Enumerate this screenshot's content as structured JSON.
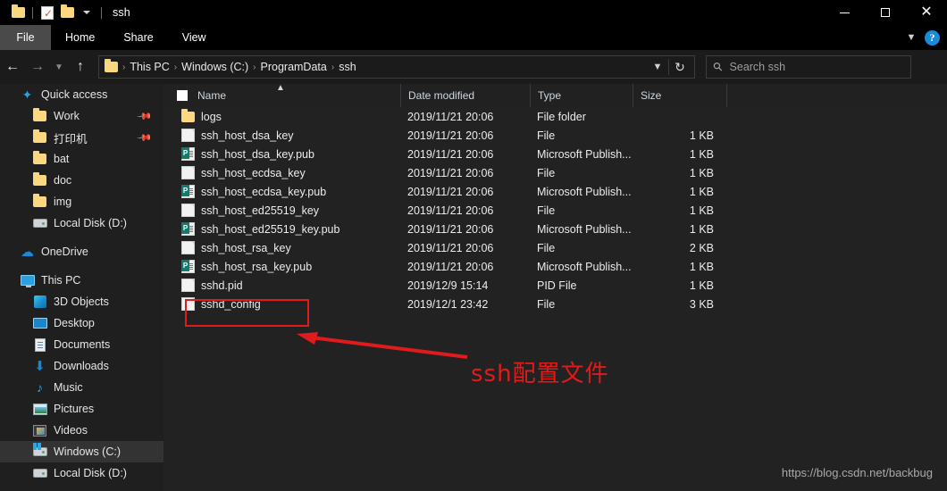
{
  "window": {
    "title": "ssh",
    "quick_access_icons": [
      "folder-icon",
      "properties-icon",
      "new-folder-icon",
      "customize-qat-caret-icon"
    ],
    "controls": {
      "minimize": "minimize-icon",
      "maximize": "maximize-icon",
      "close": "close-icon"
    }
  },
  "ribbon": {
    "tabs": [
      {
        "label": "File",
        "active": true
      },
      {
        "label": "Home",
        "active": false
      },
      {
        "label": "Share",
        "active": false
      },
      {
        "label": "View",
        "active": false
      }
    ],
    "collapse_icon": "chevron-down-icon",
    "help_icon": "help-icon",
    "help_glyph": "?"
  },
  "navigation": {
    "back": "back-arrow-icon",
    "forward": "forward-arrow-icon",
    "recent": "recent-locations-caret-icon",
    "up": "up-arrow-icon",
    "breadcrumbs": [
      "This PC",
      "Windows (C:)",
      "ProgramData",
      "ssh"
    ],
    "breadcrumb_separator": "›",
    "dropdown_icon": "chevron-down-icon",
    "refresh_icon": "refresh-icon",
    "refresh_glyph": "↻"
  },
  "search": {
    "placeholder": "Search ssh",
    "icon": "search-icon",
    "value": ""
  },
  "sidebar": {
    "items": [
      {
        "label": "Quick access",
        "icon": "star-icon",
        "level": 0,
        "pinned": false,
        "selected": false
      },
      {
        "label": "Work",
        "icon": "folder-icon",
        "level": 1,
        "pinned": true,
        "selected": false
      },
      {
        "label": "打印机",
        "icon": "folder-icon",
        "level": 1,
        "pinned": true,
        "selected": false
      },
      {
        "label": "bat",
        "icon": "folder-icon",
        "level": 1,
        "pinned": false,
        "selected": false
      },
      {
        "label": "doc",
        "icon": "folder-icon",
        "level": 1,
        "pinned": false,
        "selected": false
      },
      {
        "label": "img",
        "icon": "folder-icon",
        "level": 1,
        "pinned": false,
        "selected": false
      },
      {
        "label": "Local Disk (D:)",
        "icon": "drive-icon",
        "level": 1,
        "pinned": false,
        "selected": false
      },
      {
        "label": "OneDrive",
        "icon": "cloud-icon",
        "level": 0,
        "pinned": false,
        "selected": false
      },
      {
        "label": "This PC",
        "icon": "computer-icon",
        "level": 0,
        "pinned": false,
        "selected": false
      },
      {
        "label": "3D Objects",
        "icon": "3d-objects-icon",
        "level": 1,
        "pinned": false,
        "selected": false
      },
      {
        "label": "Desktop",
        "icon": "desktop-icon",
        "level": 1,
        "pinned": false,
        "selected": false
      },
      {
        "label": "Documents",
        "icon": "documents-icon",
        "level": 1,
        "pinned": false,
        "selected": false
      },
      {
        "label": "Downloads",
        "icon": "downloads-icon",
        "level": 1,
        "pinned": false,
        "selected": false
      },
      {
        "label": "Music",
        "icon": "music-icon",
        "level": 1,
        "pinned": false,
        "selected": false
      },
      {
        "label": "Pictures",
        "icon": "pictures-icon",
        "level": 1,
        "pinned": false,
        "selected": false
      },
      {
        "label": "Videos",
        "icon": "videos-icon",
        "level": 1,
        "pinned": false,
        "selected": false
      },
      {
        "label": "Windows (C:)",
        "icon": "windows-drive-icon",
        "level": 1,
        "pinned": false,
        "selected": true
      },
      {
        "label": "Local Disk (D:)",
        "icon": "drive-icon",
        "level": 1,
        "pinned": false,
        "selected": false
      }
    ],
    "pin_icon": "pin-icon"
  },
  "filelist": {
    "columns": [
      "Name",
      "Date modified",
      "Type",
      "Size"
    ],
    "sort_column": "Name",
    "sort_direction": "ascending",
    "sort_icon": "sort-ascending-caret-icon",
    "select_all_checkbox": "select-all-checkbox",
    "rows": [
      {
        "name": "logs",
        "date": "2019/11/21 20:06",
        "type": "File folder",
        "size": "",
        "icon": "folder-icon"
      },
      {
        "name": "ssh_host_dsa_key",
        "date": "2019/11/21 20:06",
        "type": "File",
        "size": "1 KB",
        "icon": "file-icon"
      },
      {
        "name": "ssh_host_dsa_key.pub",
        "date": "2019/11/21 20:06",
        "type": "Microsoft Publish...",
        "size": "1 KB",
        "icon": "publisher-file-icon"
      },
      {
        "name": "ssh_host_ecdsa_key",
        "date": "2019/11/21 20:06",
        "type": "File",
        "size": "1 KB",
        "icon": "file-icon"
      },
      {
        "name": "ssh_host_ecdsa_key.pub",
        "date": "2019/11/21 20:06",
        "type": "Microsoft Publish...",
        "size": "1 KB",
        "icon": "publisher-file-icon"
      },
      {
        "name": "ssh_host_ed25519_key",
        "date": "2019/11/21 20:06",
        "type": "File",
        "size": "1 KB",
        "icon": "file-icon"
      },
      {
        "name": "ssh_host_ed25519_key.pub",
        "date": "2019/11/21 20:06",
        "type": "Microsoft Publish...",
        "size": "1 KB",
        "icon": "publisher-file-icon"
      },
      {
        "name": "ssh_host_rsa_key",
        "date": "2019/11/21 20:06",
        "type": "File",
        "size": "2 KB",
        "icon": "file-icon"
      },
      {
        "name": "ssh_host_rsa_key.pub",
        "date": "2019/11/21 20:06",
        "type": "Microsoft Publish...",
        "size": "1 KB",
        "icon": "publisher-file-icon"
      },
      {
        "name": "sshd.pid",
        "date": "2019/12/9 15:14",
        "type": "PID File",
        "size": "1 KB",
        "icon": "file-icon"
      },
      {
        "name": "sshd_config",
        "date": "2019/12/1 23:42",
        "type": "File",
        "size": "3 KB",
        "icon": "file-icon"
      }
    ]
  },
  "annotation": {
    "text": "ssh配置文件",
    "color": "#e01b1b",
    "highlight_target": "sshd_config",
    "arrow": "left-pointing-arrow"
  },
  "watermark": {
    "text": "https://blog.csdn.net/backbug"
  },
  "colors": {
    "window_bg": "#1e1e1e",
    "titlebar_bg": "#000000",
    "sidebar_bg": "#1f1f1f",
    "content_bg": "#222222",
    "accent_blue": "#1b8bd8",
    "annotation_red": "#e01b1b",
    "folder_yellow": "#fbd77f"
  }
}
